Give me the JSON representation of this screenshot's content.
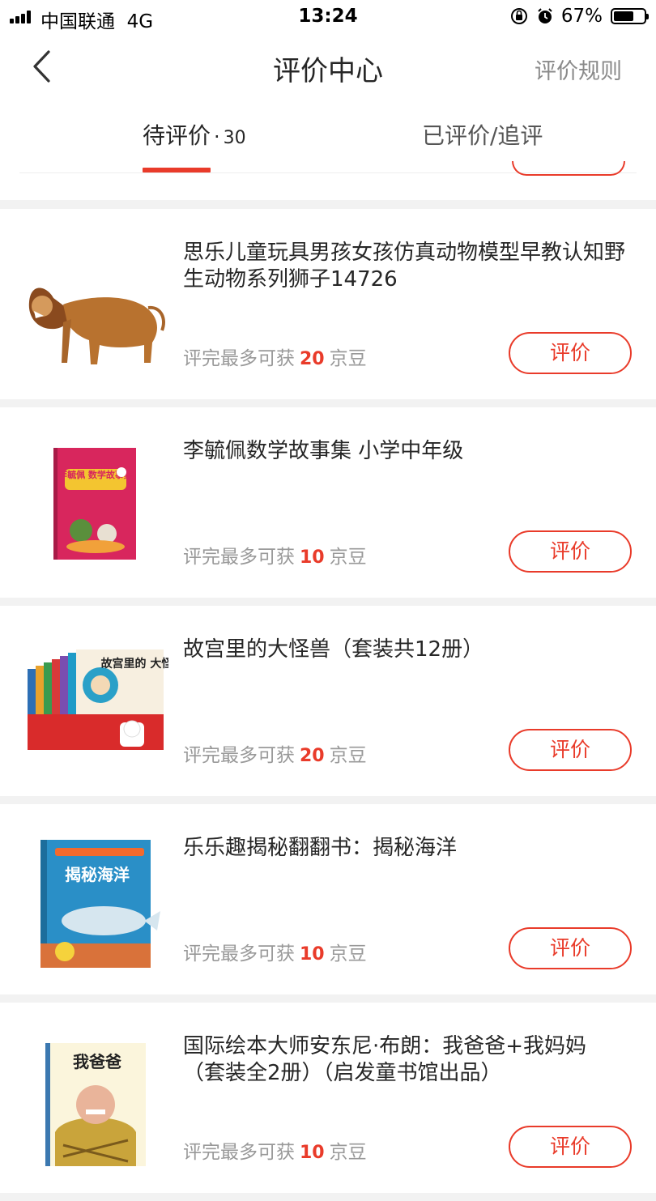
{
  "status_bar": {
    "carrier": "中国联通",
    "network": "4G",
    "time": "13:24",
    "battery_text": "67%",
    "battery_level": 0.67
  },
  "header": {
    "title": "评价中心",
    "rules_link": "评价规则"
  },
  "tabs": {
    "pending_label": "待评价",
    "pending_separator": "·",
    "pending_count": "30",
    "done_label": "已评价/追评"
  },
  "reward_text": {
    "prefix": "评完最多可获",
    "unit": "京豆"
  },
  "button_label": "评价",
  "products": [
    {
      "title": "思乐儿童玩具男孩女孩仿真动物模型早教认知野生动物系列狮子14726",
      "beans": "20",
      "image": "lion-figure"
    },
    {
      "title": "李毓佩数学故事集 小学中年级",
      "beans": "10",
      "image": "math-story-book-cover"
    },
    {
      "title": "故宫里的大怪兽（套装共12册）",
      "beans": "20",
      "image": "forbidden-city-monster-box-set"
    },
    {
      "title": "乐乐趣揭秘翻翻书：揭秘海洋",
      "beans": "10",
      "image": "ocean-flap-book-cover"
    },
    {
      "title": "国际绘本大师安东尼·布朗：我爸爸+我妈妈（套装全2册）（启发童书馆出品）",
      "beans": "10",
      "image": "my-dad-picture-book-cover"
    }
  ],
  "cover_text": {
    "math_book": "李毓佩 数学故事集",
    "monster_book": "故宫里的 大怪兽",
    "ocean_book": "揭秘海洋",
    "dad_book": "我爸爸"
  },
  "colors": {
    "accent": "#e93b2a",
    "background": "#f2f2f2",
    "muted_text": "#999999"
  }
}
